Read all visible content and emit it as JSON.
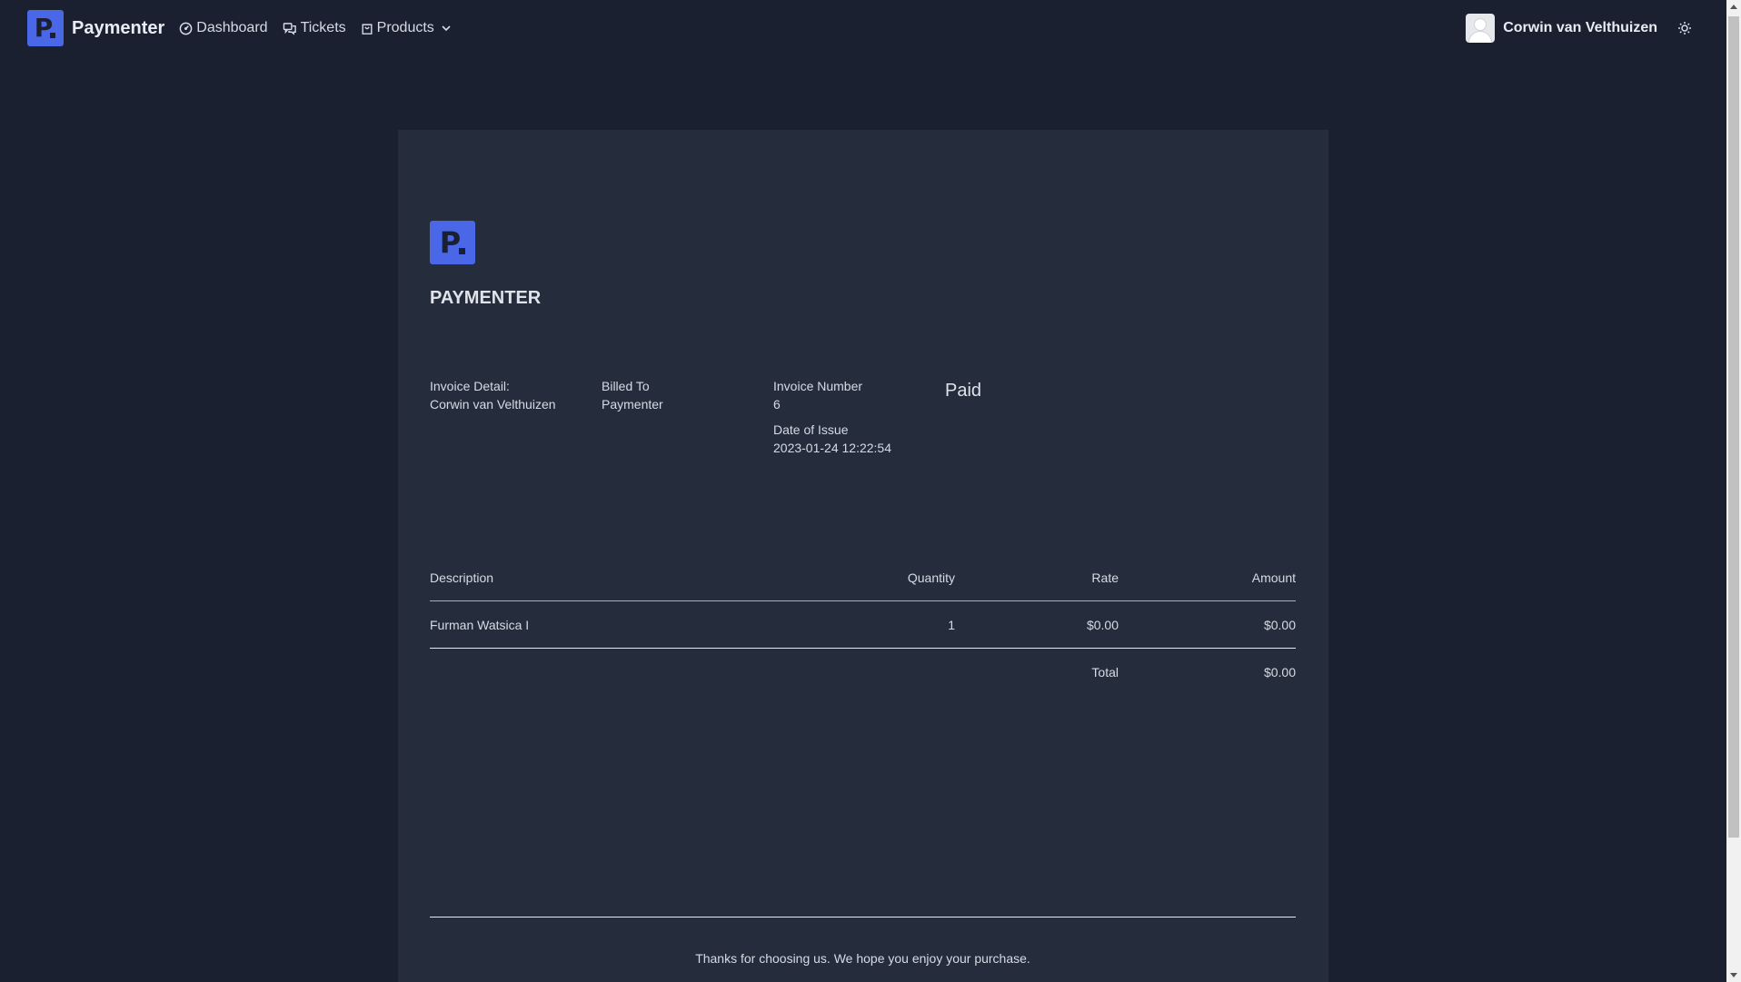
{
  "navbar": {
    "brand": "Paymenter",
    "links": [
      {
        "label": "Dashboard",
        "icon": "dashboard-icon"
      },
      {
        "label": "Tickets",
        "icon": "tickets-icon"
      },
      {
        "label": "Products",
        "icon": "products-icon"
      }
    ],
    "user_name": "Corwin van Velthuizen",
    "theme_icon": "sun-icon"
  },
  "invoice": {
    "company_name": "PAYMENTER",
    "detail_label": "Invoice Detail:",
    "detail_value": "Corwin van Velthuizen",
    "billed_to_label": "Billed To",
    "billed_to_value": "Paymenter",
    "number_label": "Invoice Number",
    "number_value": "6",
    "date_label": "Date of Issue",
    "date_value": "2023-01-24 12:22:54",
    "status": "Paid",
    "columns": {
      "description": "Description",
      "quantity": "Quantity",
      "rate": "Rate",
      "amount": "Amount"
    },
    "items": [
      {
        "description": "Furman Watsica I",
        "quantity": "1",
        "rate": "$0.00",
        "amount": "$0.00"
      }
    ],
    "total_label": "Total",
    "total_value": "$0.00",
    "footer_text": "Thanks for choosing us. We hope you enjoy your purchase."
  },
  "colors": {
    "background": "#1a2030",
    "card": "#252c3b",
    "brand": "#4a67e8"
  }
}
